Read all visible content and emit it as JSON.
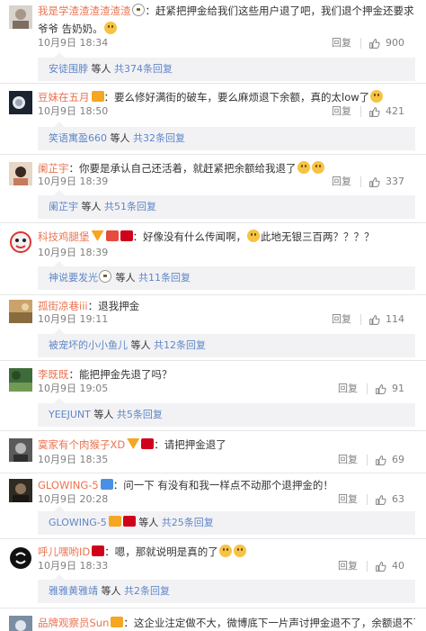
{
  "reply_label": "回复",
  "others_label": "等人",
  "comments": [
    {
      "user": "我是学渣渣渣渣渣渣",
      "text_a": "：赶紧把押金给我们这些用户退了吧，我们退个押金还要求爷爷 告奶奶。",
      "time": "10月9日 18:34",
      "likes": "900",
      "reply_user": "安徒围脖",
      "reply_count": "共374条回复"
    },
    {
      "user": "豆妹在五月",
      "text_a": "：要么修好满街的破车，要么麻烦退下余额，真的太low了",
      "time": "10月9日 18:50",
      "likes": "421",
      "reply_user": "笑语寓盈660",
      "reply_count": "共32条回复"
    },
    {
      "user": "阑芷宇",
      "text_a": "：你要是承认自己还活着，就赶紧把余额给我退了",
      "time": "10月9日 18:39",
      "likes": "337",
      "reply_user": "阑芷宇",
      "reply_count": "共51条回复"
    },
    {
      "user": "科技鸡腿堡",
      "text_a": "：好像没有什么传闻啊，",
      "text_b": "此地无银三百两？？？？",
      "time": "10月9日 18:39",
      "likes": "",
      "reply_user": "神说要发光",
      "reply_count": "共11条回复"
    },
    {
      "user": "孤街凉巷iii",
      "text_a": "：退我押金",
      "time": "10月9日 19:11",
      "likes": "114",
      "reply_user": "被宠坏的小小鱼儿",
      "reply_count": "共12条回复"
    },
    {
      "user": "李既既",
      "text_a": "：能把押金先退了吗？",
      "time": "10月9日 19:05",
      "likes": "91",
      "reply_user": "YEEJUNT",
      "reply_count": "共5条回复"
    },
    {
      "user": "寞家有个肉猴子XD",
      "text_a": "：请把押金退了",
      "time": "10月9日 18:35",
      "likes": "69",
      "reply_user": "",
      "reply_count": ""
    },
    {
      "user": "GLOWING-5",
      "text_a": "：问一下 有没有和我一样点不动那个退押金的！",
      "time": "10月9日 20:28",
      "likes": "63",
      "reply_user": "GLOWING-5",
      "reply_count": "共25条回复"
    },
    {
      "user": "呼儿嘿哟ID",
      "text_a": "：嗯，那就说明是真的了",
      "time": "10月9日 18:33",
      "likes": "40",
      "reply_user": "雅雅黄雅靖",
      "reply_count": "共2条回复"
    },
    {
      "user": "品牌观察员Sun",
      "text_a": "：这企业注定做不大，微博底下一片声讨押金退不了，余额退不了，公关部也没",
      "time": "",
      "likes": "",
      "reply_user": "",
      "reply_count": ""
    }
  ]
}
